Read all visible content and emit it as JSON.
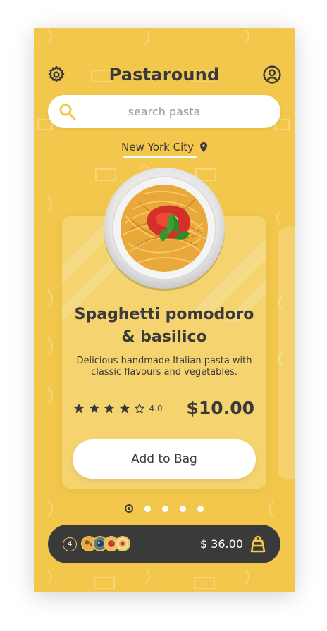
{
  "app": {
    "title": "Pastaround"
  },
  "header": {
    "settings_icon": "gear-icon",
    "profile_icon": "user-circle-icon"
  },
  "search": {
    "placeholder": "search pasta",
    "value": "",
    "icon": "search-icon"
  },
  "location": {
    "city": "New York City",
    "icon": "map-pin-icon"
  },
  "product": {
    "name_line1": "Spaghetti pomodoro",
    "name_line2": "& basilico",
    "description_line1": "Delicious handmade Italian pasta with",
    "description_line2": "classic flavours and vegetables.",
    "rating": "4.0",
    "stars_filled": 4,
    "stars_total": 5,
    "price": "$10.00",
    "add_label": "Add to Bag"
  },
  "pagination": {
    "current": 1,
    "total": 5
  },
  "bag": {
    "count": "4",
    "total": "$ 36.00",
    "icon": "shopping-bag-icon"
  },
  "colors": {
    "background": "#f2c74c",
    "card": "#f5d470",
    "dark": "#3a3a3a",
    "white": "#ffffff"
  }
}
